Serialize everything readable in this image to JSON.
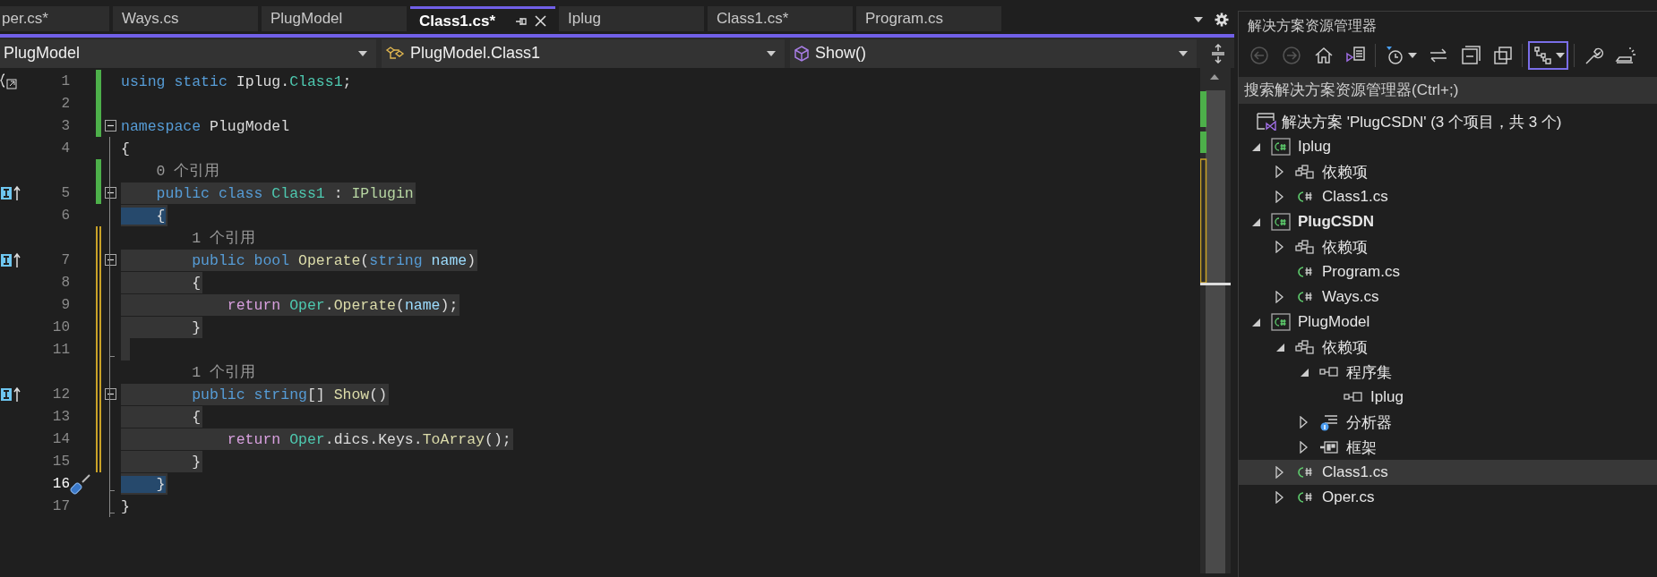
{
  "tabs": [
    {
      "label": "per.cs*",
      "selected": false
    },
    {
      "label": "Ways.cs",
      "selected": false
    },
    {
      "label": "PlugModel",
      "selected": false
    },
    {
      "label": "Class1.cs*",
      "selected": true
    },
    {
      "label": "Iplug",
      "selected": false
    },
    {
      "label": "Class1.cs*",
      "selected": false
    },
    {
      "label": "Program.cs",
      "selected": false
    }
  ],
  "navigation": {
    "project": "PlugModel",
    "type": "PlugModel.Class1",
    "member": "Show()"
  },
  "code": [
    {
      "kind": "code",
      "number": "1",
      "current": false,
      "highlighted": false,
      "change": {
        "kind": "saved"
      },
      "margin": {
        "kind": "using"
      },
      "tokens": [
        {
          "text": "using static",
          "kind": "keyword"
        },
        {
          "text": " Iplug.",
          "kind": "plain"
        },
        {
          "text": "Class1",
          "kind": "type"
        },
        {
          "text": ";",
          "kind": "plain"
        }
      ]
    },
    {
      "kind": "code",
      "number": "2",
      "current": false,
      "change": {
        "kind": "saved"
      }
    },
    {
      "kind": "code",
      "number": "3",
      "current": false,
      "highlighted": false,
      "change": {
        "kind": "saved"
      },
      "fold": {
        "kind": "start"
      },
      "tokens": [
        {
          "text": "namespace",
          "kind": "keyword"
        },
        {
          "text": " PlugModel",
          "kind": "plain"
        }
      ]
    },
    {
      "kind": "code",
      "number": "4",
      "current": false,
      "highlighted": false,
      "tokens": [
        {
          "text": "{",
          "kind": "plain"
        }
      ]
    },
    {
      "kind": "lens",
      "text": "    0 个引用",
      "change": {
        "kind": "saved"
      }
    },
    {
      "kind": "code",
      "number": "5",
      "current": false,
      "highlighted": true,
      "change": {
        "kind": "saved"
      },
      "fold": {
        "kind": "start"
      },
      "margin": {
        "kind": "implementation"
      },
      "tokens": [
        {
          "text": "    public class",
          "kind": "keyword"
        },
        {
          "text": " Class1",
          "kind": "type"
        },
        {
          "text": " :",
          "kind": "plain"
        },
        {
          "text": " IPlugin",
          "kind": "interface"
        }
      ]
    },
    {
      "kind": "code",
      "number": "6",
      "current": false,
      "highlighted": true,
      "tokens": [
        {
          "text": "    {",
          "kind": "brace-match"
        }
      ]
    },
    {
      "kind": "lens",
      "text": "        1 个引用",
      "change": {
        "kind": "unsaved"
      }
    },
    {
      "kind": "code",
      "number": "7",
      "current": false,
      "highlighted": true,
      "change": {
        "kind": "unsaved"
      },
      "fold": {
        "kind": "start"
      },
      "margin": {
        "kind": "implementation"
      },
      "tokens": [
        {
          "text": "        public bool",
          "kind": "keyword"
        },
        {
          "text": " Operate",
          "kind": "method"
        },
        {
          "text": "(",
          "kind": "plain"
        },
        {
          "text": "string",
          "kind": "keyword"
        },
        {
          "text": " name",
          "kind": "parameter"
        },
        {
          "text": ")",
          "kind": "plain"
        }
      ]
    },
    {
      "kind": "code",
      "number": "8",
      "current": false,
      "highlighted": true,
      "change": {
        "kind": "unsaved"
      },
      "tokens": [
        {
          "text": "        {",
          "kind": "plain"
        }
      ]
    },
    {
      "kind": "code",
      "number": "9",
      "current": false,
      "highlighted": true,
      "change": {
        "kind": "unsaved"
      },
      "tokens": [
        {
          "text": "            return",
          "kind": "control"
        },
        {
          "text": " Oper",
          "kind": "type"
        },
        {
          "text": ".",
          "kind": "plain"
        },
        {
          "text": "Operate",
          "kind": "method"
        },
        {
          "text": "(",
          "kind": "plain"
        },
        {
          "text": "name",
          "kind": "parameter"
        },
        {
          "text": ");",
          "kind": "plain"
        }
      ]
    },
    {
      "kind": "code",
      "number": "10",
      "current": false,
      "highlighted": true,
      "change": {
        "kind": "unsaved"
      },
      "tokens": [
        {
          "text": "        }",
          "kind": "plain"
        }
      ]
    },
    {
      "kind": "code",
      "number": "11",
      "current": false,
      "highlighted": true,
      "change": {
        "kind": "unsaved"
      },
      "fold": {
        "kind": "end"
      }
    },
    {
      "kind": "lens",
      "text": "        1 个引用",
      "change": {
        "kind": "unsaved"
      }
    },
    {
      "kind": "code",
      "number": "12",
      "current": false,
      "highlighted": true,
      "change": {
        "kind": "unsaved"
      },
      "fold": {
        "kind": "start"
      },
      "margin": {
        "kind": "implementation"
      },
      "tokens": [
        {
          "text": "        public string",
          "kind": "keyword"
        },
        {
          "text": "[]",
          "kind": "plain"
        },
        {
          "text": " Show",
          "kind": "method"
        },
        {
          "text": "()",
          "kind": "plain"
        }
      ]
    },
    {
      "kind": "code",
      "number": "13",
      "current": false,
      "highlighted": true,
      "change": {
        "kind": "unsaved"
      },
      "tokens": [
        {
          "text": "        {",
          "kind": "plain"
        }
      ]
    },
    {
      "kind": "code",
      "number": "14",
      "current": false,
      "highlighted": true,
      "change": {
        "kind": "unsaved"
      },
      "tokens": [
        {
          "text": "            return",
          "kind": "control"
        },
        {
          "text": " Oper",
          "kind": "type"
        },
        {
          "text": ".dics.Keys.",
          "kind": "plain"
        },
        {
          "text": "ToArray",
          "kind": "method"
        },
        {
          "text": "();",
          "kind": "plain"
        }
      ]
    },
    {
      "kind": "code",
      "number": "15",
      "current": false,
      "highlighted": true,
      "change": {
        "kind": "unsaved"
      },
      "tokens": [
        {
          "text": "        }",
          "kind": "plain"
        }
      ]
    },
    {
      "kind": "code",
      "number": "16",
      "current": true,
      "highlighted": true,
      "fold": {
        "kind": "end"
      },
      "margin": {
        "kind": "quick-action"
      },
      "tokens": [
        {
          "text": "    }",
          "kind": "brace-match"
        }
      ]
    },
    {
      "kind": "code",
      "number": "17",
      "current": false,
      "highlighted": false,
      "fold": {
        "kind": "end"
      },
      "tokens": [
        {
          "text": "}",
          "kind": "plain"
        }
      ]
    }
  ],
  "solution_explorer": {
    "title": "解决方案资源管理器",
    "toolbar": [
      {
        "kind": "back",
        "disabled": true,
        "selected": false
      },
      {
        "kind": "forward",
        "disabled": true,
        "selected": false
      },
      {
        "kind": "home",
        "disabled": false,
        "selected": false
      },
      {
        "kind": "switch-views",
        "disabled": false,
        "selected": false
      },
      {
        "kind": "pending-changes",
        "disabled": false,
        "selected": false
      },
      {
        "kind": "sync",
        "disabled": false,
        "selected": false
      },
      {
        "kind": "collapse-all",
        "disabled": false,
        "selected": false
      },
      {
        "kind": "show-all",
        "disabled": false,
        "selected": false
      },
      {
        "kind": "tree-view",
        "disabled": false,
        "selected": true
      },
      {
        "kind": "properties",
        "disabled": false,
        "selected": false
      },
      {
        "kind": "preview",
        "disabled": false,
        "selected": false
      }
    ],
    "search": {
      "placeholder": "搜索解决方案资源管理器(Ctrl+;)"
    },
    "solution": {
      "label": "解决方案 'PlugCSDN' (3 个项目，共 3 个)",
      "selected": false
    },
    "projects": [
      {
        "label": "Iplug",
        "kind": "project",
        "startup": false,
        "expanded": true,
        "selected": false,
        "children": [
          {
            "label": "依赖项",
            "kind": "dependencies",
            "expanded": false,
            "selected": false
          },
          {
            "label": "Class1.cs",
            "kind": "csharp-file",
            "expanded": false,
            "selected": false
          }
        ]
      },
      {
        "label": "PlugCSDN",
        "kind": "project",
        "startup": true,
        "expanded": true,
        "selected": false,
        "children": [
          {
            "label": "依赖项",
            "kind": "dependencies",
            "expanded": false,
            "selected": false
          },
          {
            "label": "Program.cs",
            "kind": "csharp-file",
            "selected": false
          },
          {
            "label": "Ways.cs",
            "kind": "csharp-file",
            "expanded": false,
            "selected": false
          }
        ]
      },
      {
        "label": "PlugModel",
        "kind": "project",
        "startup": false,
        "expanded": true,
        "selected": false,
        "children": [
          {
            "label": "依赖项",
            "kind": "dependencies",
            "expanded": true,
            "selected": false,
            "children": [
              {
                "label": "程序集",
                "kind": "assembly",
                "expanded": true,
                "selected": false,
                "children": [
                  {
                    "label": "Iplug",
                    "kind": "assembly",
                    "selected": false
                  }
                ]
              },
              {
                "label": "分析器",
                "kind": "analyzer",
                "expanded": false,
                "selected": false
              },
              {
                "label": "框架",
                "kind": "framework",
                "expanded": false,
                "selected": false
              }
            ]
          },
          {
            "label": "Class1.cs",
            "kind": "csharp-file",
            "expanded": false,
            "selected": true
          },
          {
            "label": "Oper.cs",
            "kind": "csharp-file",
            "expanded": false,
            "selected": false
          }
        ]
      }
    ]
  }
}
